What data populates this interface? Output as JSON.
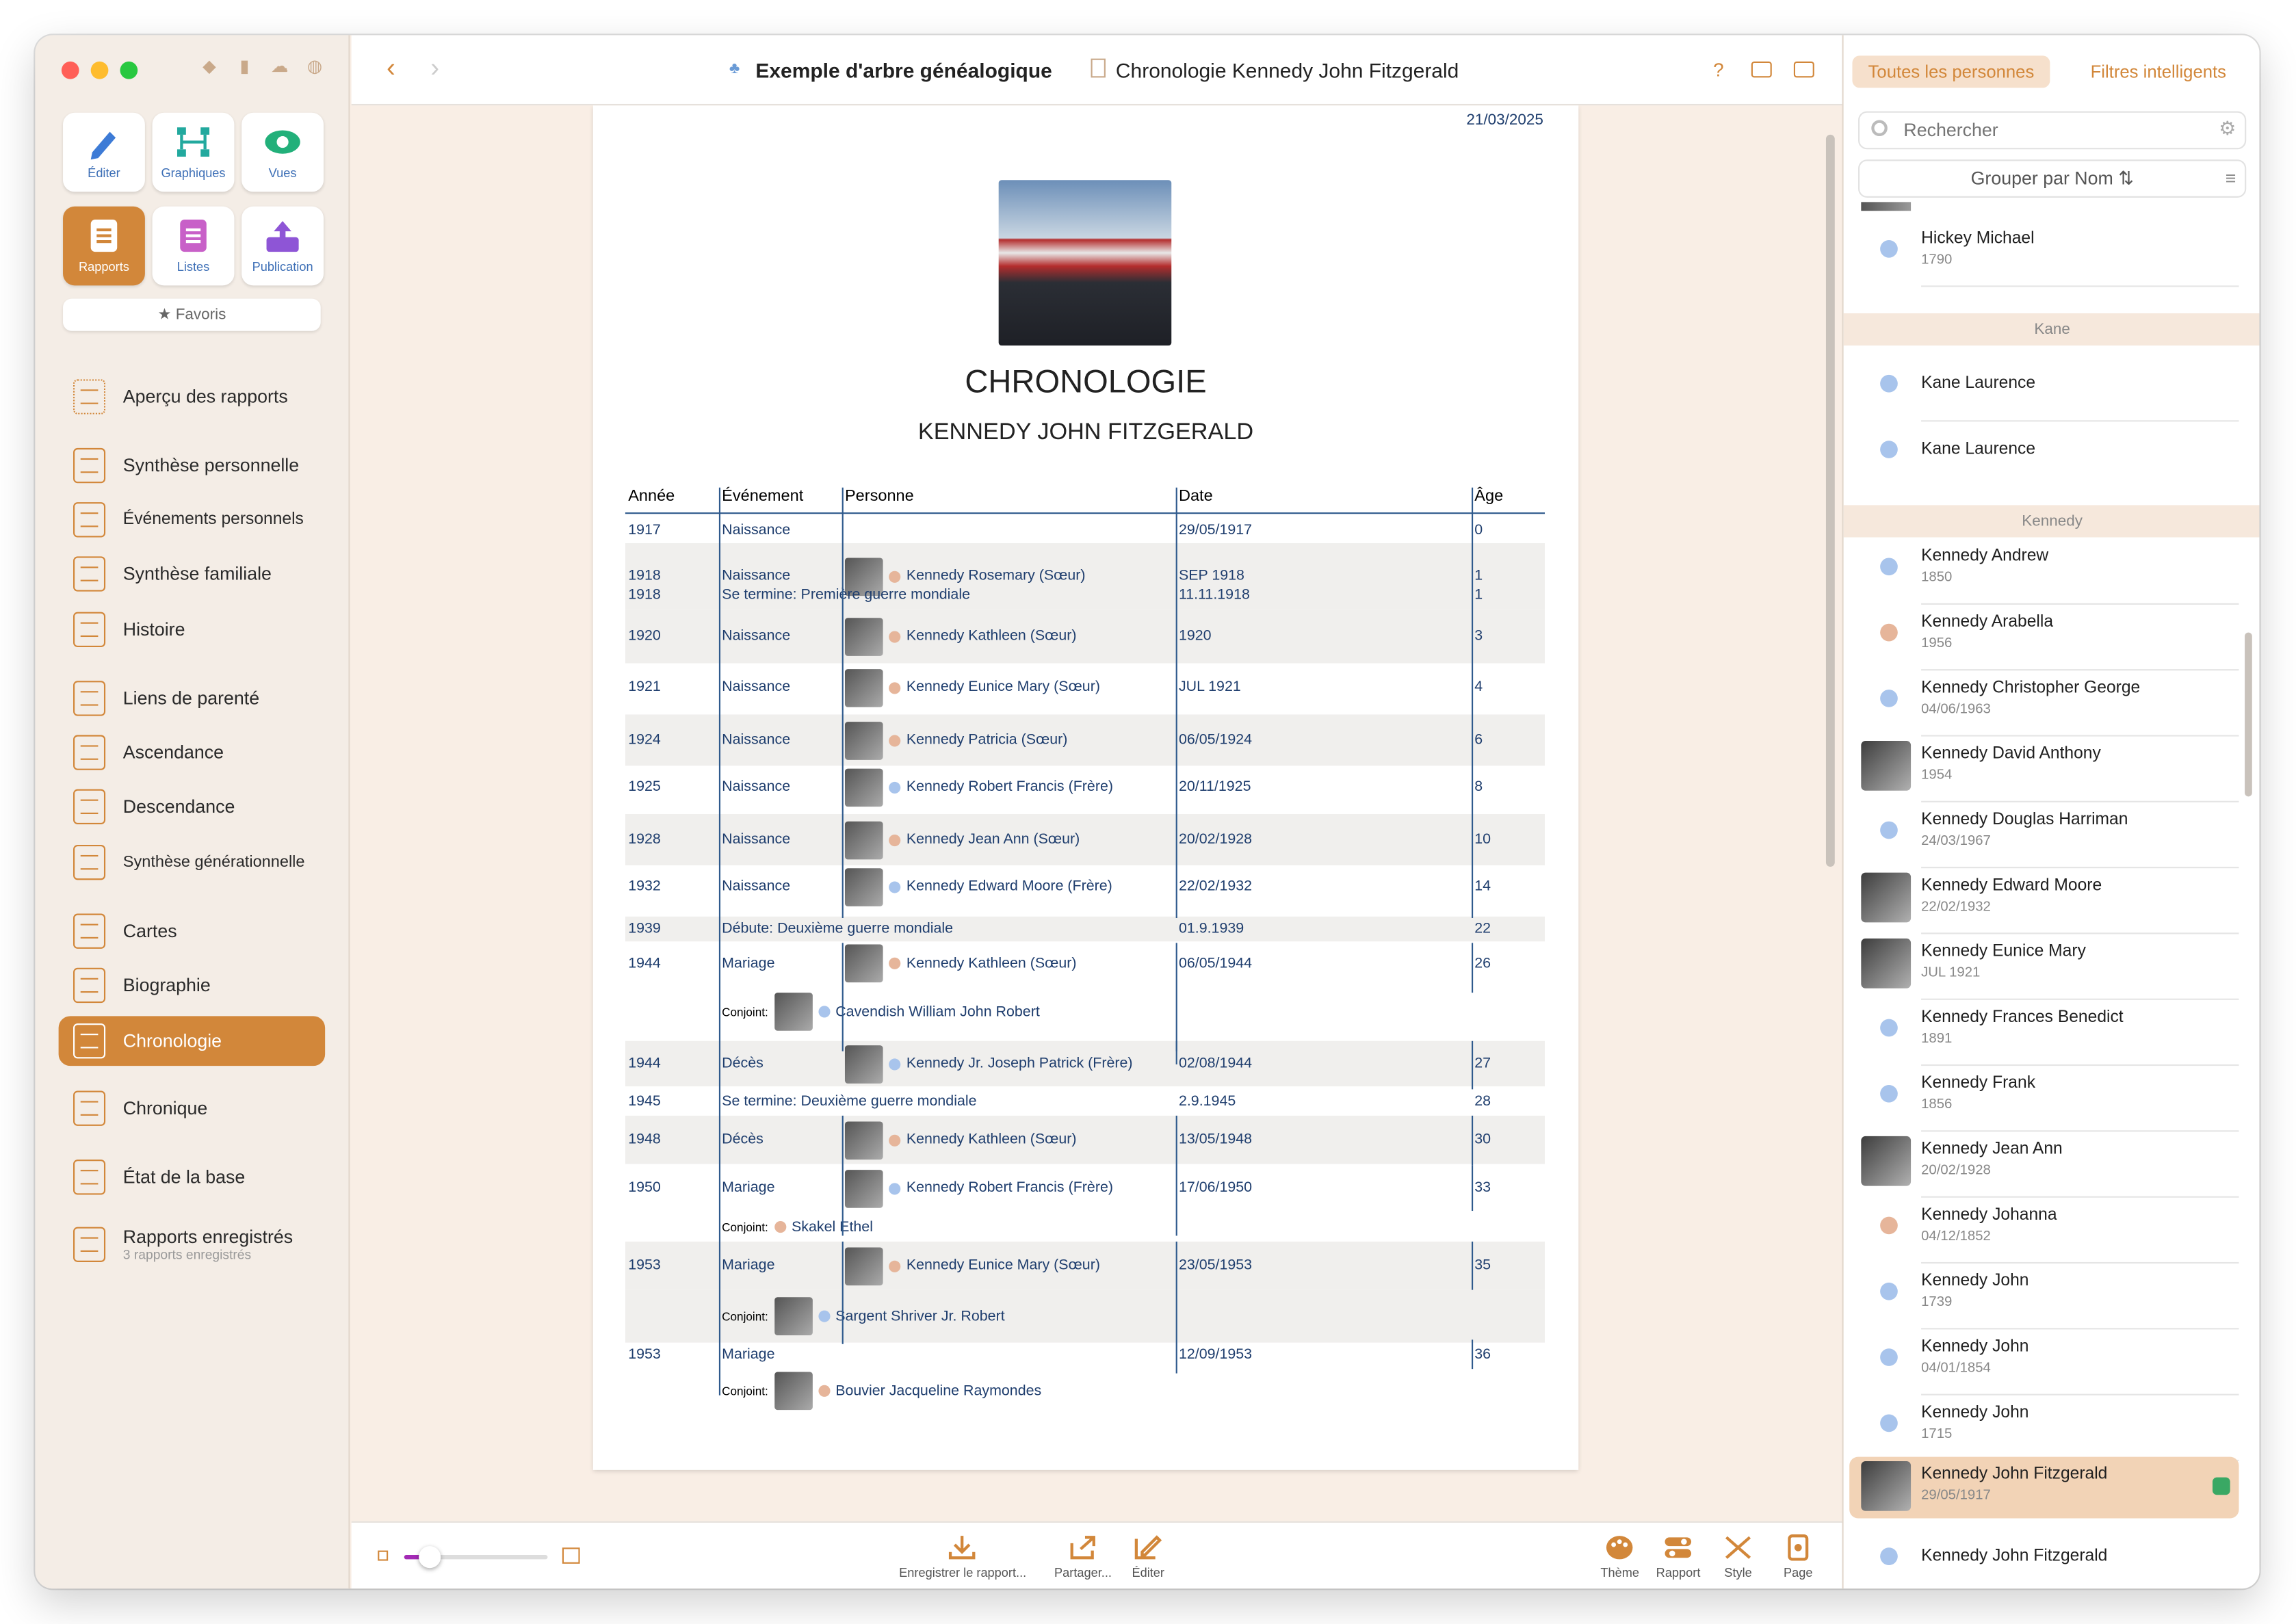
{
  "sidebar": {
    "tools": [
      {
        "label": "Éditer"
      },
      {
        "label": "Graphiques"
      },
      {
        "label": "Vues"
      },
      {
        "label": "Rapports"
      },
      {
        "label": "Listes"
      },
      {
        "label": "Publication"
      }
    ],
    "favoris": "★ Favoris",
    "items": [
      {
        "label": "Aperçu des rapports"
      },
      {
        "label": "Synthèse personnelle"
      },
      {
        "label": "Événements personnels"
      },
      {
        "label": "Synthèse familiale"
      },
      {
        "label": "Histoire"
      },
      {
        "label": "Liens de parenté"
      },
      {
        "label": "Ascendance"
      },
      {
        "label": "Descendance"
      },
      {
        "label": "Synthèse générationnelle"
      },
      {
        "label": "Cartes"
      },
      {
        "label": "Biographie"
      },
      {
        "label": "Chronologie"
      },
      {
        "label": "Chronique"
      },
      {
        "label": "État de la base"
      },
      {
        "label": "Rapports enregistrés",
        "sub": "3 rapports enregistrés"
      }
    ]
  },
  "header": {
    "tree": "Exemple d'arbre généalogique",
    "document": "Chronologie Kennedy John Fitzgerald",
    "help": "?"
  },
  "report": {
    "date": "21/03/2025",
    "title": "CHRONOLOGIE",
    "subject": "KENNEDY JOHN FITZGERALD",
    "columns": [
      "Année",
      "Événement",
      "Personne",
      "Date",
      "Âge"
    ],
    "rows": [
      {
        "year": "1917",
        "event": "Naissance",
        "person": "",
        "date": "29/05/1917",
        "age": "0"
      },
      {
        "year": "1918",
        "event": "Naissance",
        "person": "Kennedy Rosemary (Sœur)",
        "date": "SEP 1918",
        "age": "1"
      },
      {
        "year": "1918",
        "event": "Se termine: Première guerre mondiale",
        "person": "",
        "date": "11.11.1918",
        "age": "1"
      },
      {
        "year": "1920",
        "event": "Naissance",
        "person": "Kennedy Kathleen (Sœur)",
        "date": "1920",
        "age": "3"
      },
      {
        "year": "1921",
        "event": "Naissance",
        "person": "Kennedy Eunice Mary (Sœur)",
        "date": "JUL 1921",
        "age": "4"
      },
      {
        "year": "1924",
        "event": "Naissance",
        "person": "Kennedy Patricia (Sœur)",
        "date": "06/05/1924",
        "age": "6"
      },
      {
        "year": "1925",
        "event": "Naissance",
        "person": "Kennedy Robert Francis (Frère)",
        "date": "20/11/1925",
        "age": "8"
      },
      {
        "year": "1928",
        "event": "Naissance",
        "person": "Kennedy Jean Ann (Sœur)",
        "date": "20/02/1928",
        "age": "10"
      },
      {
        "year": "1932",
        "event": "Naissance",
        "person": "Kennedy Edward Moore (Frère)",
        "date": "22/02/1932",
        "age": "14"
      },
      {
        "year": "1939",
        "event": "Débute: Deuxième guerre mondiale",
        "person": "",
        "date": "01.9.1939",
        "age": "22"
      },
      {
        "year": "1944",
        "event": "Mariage",
        "person": "Kennedy Kathleen (Sœur)",
        "date": "06/05/1944",
        "age": "26",
        "spouse": "Cavendish William John Robert"
      },
      {
        "year": "1944",
        "event": "Décès",
        "person": "Kennedy Jr. Joseph Patrick (Frère)",
        "date": "02/08/1944",
        "age": "27"
      },
      {
        "year": "1945",
        "event": "Se termine: Deuxième guerre mondiale",
        "person": "",
        "date": "2.9.1945",
        "age": "28"
      },
      {
        "year": "1948",
        "event": "Décès",
        "person": "Kennedy Kathleen (Sœur)",
        "date": "13/05/1948",
        "age": "30"
      },
      {
        "year": "1950",
        "event": "Mariage",
        "person": "Kennedy Robert Francis (Frère)",
        "date": "17/06/1950",
        "age": "33",
        "spouse": "Skakel Ethel"
      },
      {
        "year": "1953",
        "event": "Mariage",
        "person": "Kennedy Eunice Mary (Sœur)",
        "date": "23/05/1953",
        "age": "35",
        "spouse": "Sargent Shriver Jr. Robert"
      },
      {
        "year": "1953",
        "event": "Mariage",
        "person": "",
        "date": "12/09/1953",
        "age": "36",
        "spouse": "Bouvier Jacqueline Raymondes"
      }
    ],
    "spouse_label": "Conjoint:"
  },
  "bottombar": {
    "save": "Enregistrer le rapport...",
    "share": "Partager...",
    "edit": "Éditer",
    "theme": "Thème",
    "report": "Rapport",
    "style": "Style",
    "page": "Page"
  },
  "right": {
    "tabs": [
      "Toutes les personnes",
      "Filtres intelligents"
    ],
    "search_placeholder": "Rechercher",
    "group": "Grouper par Nom",
    "groups": {
      "kane": "Kane",
      "kennedy": "Kennedy"
    },
    "people": [
      {
        "name": "Hickey Michael",
        "date": "1790"
      },
      {
        "name": "Kane Laurence",
        "date": ""
      },
      {
        "name": "Kane Laurence",
        "date": ""
      },
      {
        "name": "Kennedy Andrew",
        "date": "1850"
      },
      {
        "name": "Kennedy Arabella",
        "date": "1956"
      },
      {
        "name": "Kennedy Christopher George",
        "date": "04/06/1963"
      },
      {
        "name": "Kennedy David Anthony",
        "date": "1954"
      },
      {
        "name": "Kennedy Douglas Harriman",
        "date": "24/03/1967"
      },
      {
        "name": "Kennedy Edward Moore",
        "date": "22/02/1932"
      },
      {
        "name": "Kennedy Eunice Mary",
        "date": "JUL 1921"
      },
      {
        "name": "Kennedy Frances Benedict",
        "date": "1891"
      },
      {
        "name": "Kennedy Frank",
        "date": "1856"
      },
      {
        "name": "Kennedy Jean Ann",
        "date": "20/02/1928"
      },
      {
        "name": "Kennedy Johanna",
        "date": "04/12/1852"
      },
      {
        "name": "Kennedy John",
        "date": "1739"
      },
      {
        "name": "Kennedy John",
        "date": "04/01/1854"
      },
      {
        "name": "Kennedy John",
        "date": "1715"
      },
      {
        "name": "Kennedy John Fitzgerald",
        "date": "29/05/1917"
      },
      {
        "name": "Kennedy John Fitzgerald",
        "date": ""
      }
    ]
  },
  "colors": {
    "accent": "#d2873a",
    "link": "#1f3e6e",
    "selected": "#f2d3b6"
  }
}
